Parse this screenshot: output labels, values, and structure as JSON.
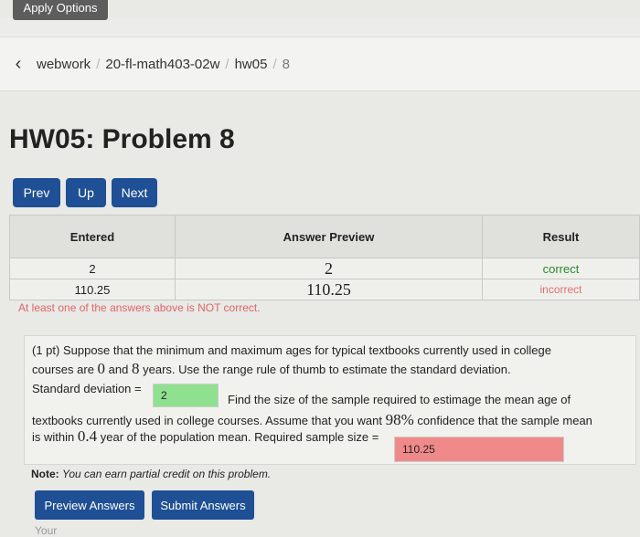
{
  "toolbar": {
    "apply_options": "Apply Options"
  },
  "breadcrumb": {
    "back_glyph": "‹",
    "items": [
      "webwork",
      "20-fl-math403-02w",
      "hw05",
      "8"
    ]
  },
  "page_title": "HW05: Problem 8",
  "nav_buttons": {
    "prev": "Prev",
    "up": "Up",
    "next": "Next"
  },
  "answers_table": {
    "headers": [
      "Entered",
      "Answer Preview",
      "Result"
    ],
    "rows": [
      {
        "entered": "2",
        "preview": "2",
        "result": "correct"
      },
      {
        "entered": "110.25",
        "preview": "110.25",
        "result": "incorrect"
      }
    ]
  },
  "warning": "At least one of the answers above is NOT correct.",
  "problem": {
    "line1": "(1 pt) Suppose that the minimum and maximum ages for typical textbooks currently used in college",
    "line2_a": "courses are",
    "min_age": "0",
    "line2_b": "and",
    "max_age": "8",
    "line2_c": "years. Use the range rule of thumb to estimate the standard deviation.",
    "sd_label": "Standard deviation =",
    "sd_value": "2",
    "line3_b": "Find the size of the sample required to estimage the mean age of",
    "line4_a": "textbooks currently used in college courses. Assume that you want",
    "confidence": "98%",
    "line4_b": "confidence that the sample mean",
    "line5_a": "is within",
    "margin": "0.4",
    "line5_b": "year of the population mean. Required sample size =",
    "sample_value": "110.25"
  },
  "note": {
    "label": "Note:",
    "text": "You can earn partial credit on this problem."
  },
  "submit_buttons": {
    "preview": "Preview Answers",
    "submit": "Submit Answers"
  },
  "footer_text": "Your"
}
